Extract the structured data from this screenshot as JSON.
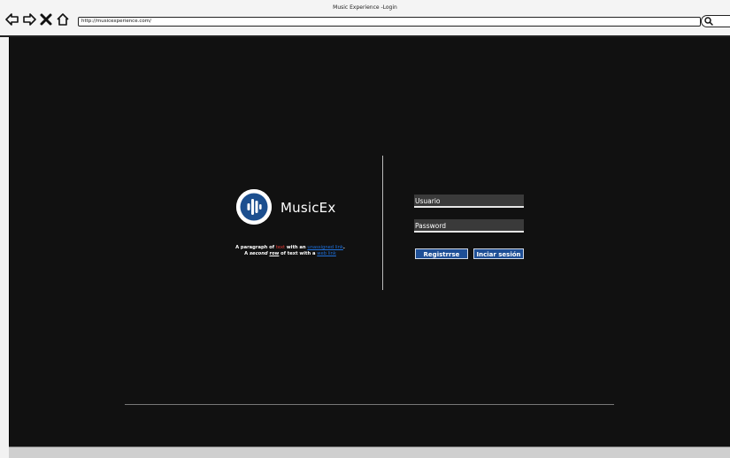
{
  "window": {
    "title": "Music Experience -Login",
    "url": "http://musicexperience.com/"
  },
  "icons": {
    "back": "back-arrow-icon",
    "forward": "forward-arrow-icon",
    "stop": "close-icon",
    "home": "home-icon",
    "search": "search-icon",
    "logo": "audio-bars-icon"
  },
  "brand": {
    "name": "MusicEx"
  },
  "paragraph": {
    "line1_a": "A paragraph of ",
    "line1_red": "text",
    "line1_b": " with an ",
    "line1_link": "unassigned link",
    "line1_end": ".",
    "line2_a": "A ",
    "line2_em": "second",
    "line2_sp": " ",
    "line2_u": "row",
    "line2_b": " of text with a ",
    "line2_link": "web link"
  },
  "form": {
    "username_placeholder": "Usuario",
    "password_placeholder": "Password",
    "register_label": "Registrrse",
    "login_label": "Inciar sesión"
  },
  "colors": {
    "background": "#111111",
    "button": "#1e4f96",
    "link": "#1e6fd9",
    "accent_red": "#e53935"
  }
}
